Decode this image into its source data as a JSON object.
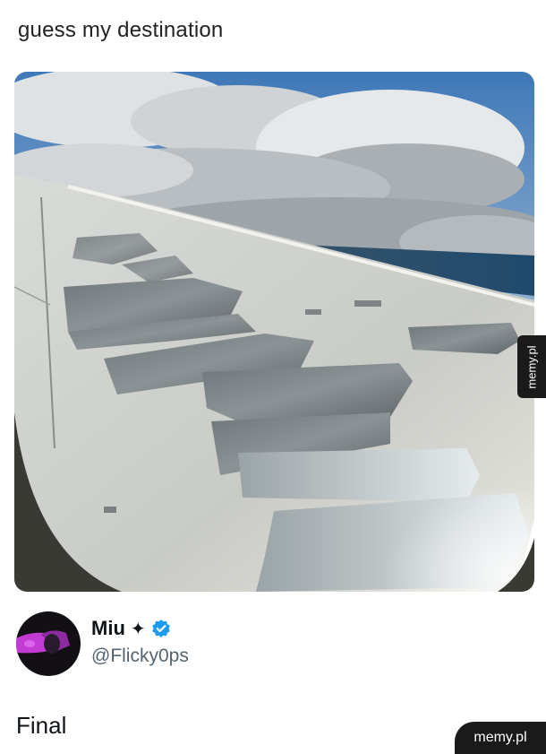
{
  "post": {
    "caption": "guess my destination"
  },
  "photo": {
    "icon": "airplane-wing-photo"
  },
  "tweet": {
    "display_name": "Miu",
    "name_symbol": "✦",
    "handle": "@Flicky0ps",
    "text": "Final"
  },
  "watermarks": {
    "side": "memy.pl",
    "bottom": "memy.pl"
  },
  "colors": {
    "verified": "#1d9bf0",
    "avatar_accent": "#c23bd4",
    "watermark_bg": "#1a1a1a"
  }
}
